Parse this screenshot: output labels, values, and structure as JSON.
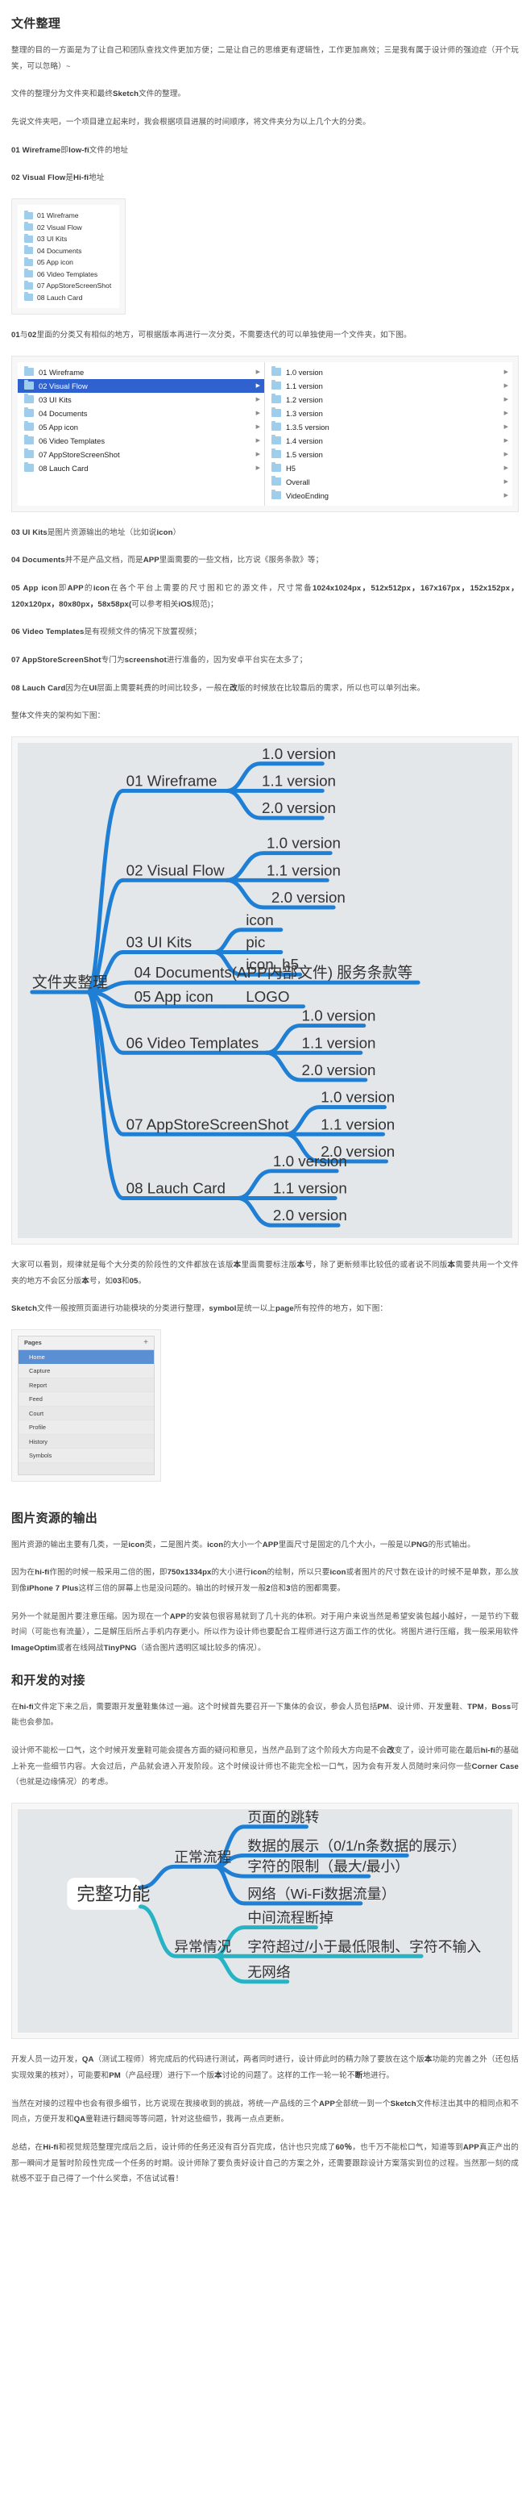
{
  "sections": {
    "files": {
      "title": "文件整理",
      "p1": "整理的目的一方面是为了让自己和团队查找文件更加方便；二是让自己的思维更有逻辑性，工作更加高效；三是我有属于设计师的强迫症（开个玩笑，可以忽略）~",
      "p2_a": "文件的整理分为文件夹和最终",
      "p2_b": "Sketch",
      "p2_c": "文件的整理。",
      "p3": "先说文件夹吧，一个项目建立起来时，我会根据项目进展的时间顺序，将文件夹分为以上几个大的分类。",
      "h01_a": "01 Wireframe",
      "h01_b": "即",
      "h01_c": "low-fi",
      "h01_d": "文件的地址",
      "h02_a": "02 Visual Flow",
      "h02_b": "是",
      "h02_c": "Hi-fi",
      "h02_d": "地址",
      "p4_a": "01",
      "p4_b": "与",
      "p4_c": "02",
      "p4_d": "里面的分类又有相似的地方，可根据版本再进行一次分类，不需要迭代的可以单独使用一个文件夹，如下图。",
      "b03_a": "03 UI Kits",
      "b03_b": "是图片资源输出的地址（比如说",
      "b03_c": "icon",
      "b03_d": "）",
      "b04_a": "04 Documents",
      "b04_b": "并不是产品文档，而是",
      "b04_c": "APP",
      "b04_d": "里面需要的一些文档，比方说《服务条款》等；",
      "b05_a": "05 App icon",
      "b05_b": "即",
      "b05_c": "APP",
      "b05_d": "的",
      "b05_e": "icon",
      "b05_f": "在各个平台上需要的尺寸图和它的源文件，尺寸常备",
      "b05_g": "1024x1024px，512x512px，167x167px，152x152px，120x120px，80x80px，58x58px(",
      "b05_h": "可以参考相关",
      "b05_i": "iOS",
      "b05_j": "规范)；",
      "b06_a": "06 Video Templates",
      "b06_b": "是有视频文件的情况下放置视频；",
      "b07_a": "07 AppStoreScreenShot",
      "b07_b": "专门为",
      "b07_c": "screenshot",
      "b07_d": "进行准备的，因为安卓平台实在太多了；",
      "b08_a": "08 Lauch Card",
      "b08_b": "因为在",
      "b08_c": "UI",
      "b08_d": "层面上需要耗费的时间比较多，一般在",
      "b08_e": "改",
      "b08_f": "版的时候放在比较靠后的需求，所以也可以单列出来。",
      "p5": "整体文件夹的架构如下图：",
      "p6_a": "大家可以看到，规律就是每个大分类的阶段性的文件都放在该版",
      "p6_b": "本",
      "p6_c": "里面需要标注版",
      "p6_d": "本",
      "p6_e": "号，除了更新频率比较低的或者说不同版",
      "p6_f": "本",
      "p6_g": "需要共用一个文件夹的地方不会区分版",
      "p6_h": "本",
      "p6_i": "号，如",
      "p6_j": "03",
      "p6_k": "和",
      "p6_l": "05",
      "p6_m": "。",
      "p7_a": "Sketch",
      "p7_b": "文件一般按照页面进行功能模块的分类进行整理，",
      "p7_c": "symbol",
      "p7_d": "是统一以上",
      "p7_e": "page",
      "p7_f": "所有控件的地方，如下图："
    },
    "images": {
      "title": "图片资源的输出",
      "p1_a": "图片资源的输出主要有几类，一是",
      "p1_b": "icon",
      "p1_c": "类，二是图片类。",
      "p1_d": "icon",
      "p1_e": "的大小一个",
      "p1_f": "APP",
      "p1_g": "里面尺寸是固定的几个大小，一般是以",
      "p1_h": "PNG",
      "p1_i": "的形式输出。",
      "p2_a": "因为在",
      "p2_b": "hi-fi",
      "p2_c": "作图的时候一般采用二倍的图，即",
      "p2_d": "750x1334px",
      "p2_e": "的大小进行",
      "p2_f": "icon",
      "p2_g": "的绘制，所以只要",
      "p2_h": "icon",
      "p2_i": "或者图片的尺寸数在设计的时候不是单数，那么放到像",
      "p2_j": "iPhone 7 Plus",
      "p2_k": "这样三倍的屏幕上也是没问题的。输出的时候开发一般",
      "p2_l": "2",
      "p2_m": "倍和",
      "p2_n": "3",
      "p2_o": "倍的图都需要。",
      "p3_a": "另外一个就是图片要注意压缩。因为现在一个",
      "p3_b": "APP",
      "p3_c": "的安装包很容易就到了几十兆的体积。对于用户来说当然是希望安装包越小越好，一是节约下载时间（可能也有流量），二是解压后所占手机内存更小。所以作为设计师也要配合工程师进行这方面工作的优化。将图片进行压缩，我一般采用软件",
      "p3_d": "ImageOptim",
      "p3_e": "或者在线网战",
      "p3_f": "TinyPNG",
      "p3_g": "（适合图片透明区域比较多的情况）。"
    },
    "dev": {
      "title": "和开发的对接",
      "p1_a": "在",
      "p1_b": "hi-fi",
      "p1_c": "文件定下来之后，需要跟开发童鞋集体过一遍。这个时候首先要召开一下集体的会议，参会人员包括",
      "p1_d": "PM",
      "p1_e": "、设计师、开发童鞋、",
      "p1_f": "TPM",
      "p1_g": "，",
      "p1_h": "Boss",
      "p1_i": "可能也会参加。",
      "p2_a": "设计师不能松一口气，这个时候开发童鞋可能会提各方面的疑问和意见，当然产品到了这个阶段大方向是不会",
      "p2_b": "改",
      "p2_c": "变了，设计师可能在最后",
      "p2_d": "hi-fi",
      "p2_e": "的基础上补充一些细节内容。大会过后，产品就会进入开发阶段。这个时候设计师也不能完全松一口气，因为会有开发人员随时来问你一些",
      "p2_f": "Corner Case",
      "p2_g": "（也就是边缘情况）的考虑。",
      "p3_a": "开发人员一边开发，",
      "p3_b": "QA",
      "p3_c": "（测试工程师）将完成后的代码进行测试，两者同时进行，设计师此时的精力除了要放在这个版",
      "p3_d": "本",
      "p3_e": "功能的完善之外（还包括实现效果的核对），可能要和",
      "p3_f": "PM",
      "p3_g": "（产品经理）进行下一个版",
      "p3_h": "本",
      "p3_i": "讨论的问题了。这样的工作一轮一轮不",
      "p3_j": "断",
      "p3_k": "地进行。",
      "p4_a": "当然在对接的过程中也会有很多细节，比方说现在我接收到的挑战，将统一产品线的三个",
      "p4_b": "APP",
      "p4_c": "全部统一到一个",
      "p4_d": "Sketch",
      "p4_e": "文件标注出其中的相同点和不同点，方便开发和",
      "p4_f": "QA",
      "p4_g": "童鞋进行翻阅等等问题，针对这些细节，我再一点点更新。",
      "p5_a": "总结，在",
      "p5_b": "Hi-fi",
      "p5_c": "和视觉规范整理完成后之后，设计师的任务还没有百分百完成，估计也只完成了",
      "p5_d": "60％",
      "p5_e": "，也千万不能松口气，知道等到",
      "p5_f": "APP",
      "p5_g": "真正产出的那一瞬间才是暂时阶段性完成一个任务的时期。设计师除了要负责好设计自己的方案之外，还需要跟踪设计方案落实到位的过程。当然那一刻的成就感不亚于自己得了一个什么奖章，不信试试看！"
    }
  },
  "finder_simple": {
    "items": [
      "01 Wireframe",
      "02 Visual Flow",
      "03 UI Kits",
      "04 Documents",
      "05 App icon",
      "06 Video Templates",
      "07 AppStoreScreenShot",
      "08 Lauch Card"
    ]
  },
  "finder_columns": {
    "arrow_glyph": "▶",
    "selected_index": 1,
    "left": [
      "01 Wireframe",
      "02 Visual Flow",
      "03 UI Kits",
      "04 Documents",
      "05 App icon",
      "06 Video Templates",
      "07 AppStoreScreenShot",
      "08 Lauch Card"
    ],
    "right": [
      "1.0 version",
      "1.1 version",
      "1.2 version",
      "1.3 version",
      "1.3.5 version",
      "1.4 version",
      "1.5 version",
      "H5",
      "Overall",
      "VideoEnding"
    ]
  },
  "sketch_panel": {
    "header": "Pages",
    "add_glyph": "+",
    "active_index": 0,
    "items": [
      "Home",
      "Capture",
      "Report",
      "Feed",
      "Court",
      "Profile",
      "History",
      "Symbols"
    ]
  },
  "chart_data": [
    {
      "type": "mindmap",
      "title": "文件夹整理",
      "root": "文件夹整理",
      "accent": "#1f7fd4",
      "background": "#e4e7ea",
      "nodes": [
        {
          "label": "01 Wireframe",
          "children": [
            "1.0 version",
            "1.1 version",
            "2.0 version"
          ]
        },
        {
          "label": "02 Visual Flow",
          "children": [
            "1.0 version",
            "1.1 version",
            "2.0 version"
          ]
        },
        {
          "label": "03 UI Kits",
          "children": [
            "icon",
            "pic",
            "icon_h5"
          ]
        },
        {
          "label": "04 Documents(APP内部文件)",
          "children": [
            "服务条款等"
          ]
        },
        {
          "label": "05 App icon",
          "children": [
            "LOGO"
          ]
        },
        {
          "label": "06 Video Templates",
          "children": [
            "1.0 version",
            "1.1 version",
            "2.0 version"
          ]
        },
        {
          "label": "07 AppStoreScreenShot",
          "children": [
            "1.0 version",
            "1.1 version",
            "2.0 version"
          ]
        },
        {
          "label": "08 Lauch Card",
          "children": [
            "1.0 version",
            "1.1 version",
            "2.0 version"
          ]
        }
      ]
    },
    {
      "type": "mindmap",
      "title": "完整功能",
      "root": "完整功能",
      "accent": "#1f7fd4",
      "accent2": "#27b3c4",
      "background": "#e4e7ea",
      "nodes": [
        {
          "label": "正常流程",
          "children": [
            "页面的跳转",
            "数据的展示（0/1/n条数据的展示）",
            "字符的限制（最大/最小）",
            "网络（Wi-Fi数据流量）"
          ]
        },
        {
          "label": "异常情况",
          "children": [
            "中间流程断掉",
            "字符超过/小于最低限制、字符不输入",
            "无网络"
          ]
        }
      ]
    }
  ]
}
